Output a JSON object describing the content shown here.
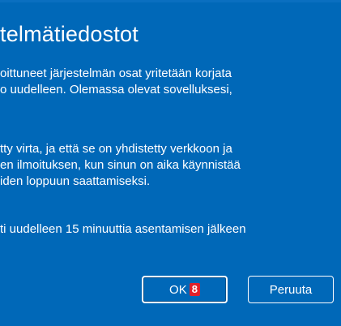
{
  "dialog": {
    "title": "telmätiedostot",
    "paragraph1": [
      "oittuneet järjestelmän osat yritetään korjata",
      "o uudelleen. Olemassa olevat sovelluksesi,"
    ],
    "paragraph2": [
      "tty virta, ja että se on yhdistetty verkkoon ja",
      "en ilmoituksen, kun sinun on aika käynnistää",
      "iden loppuun saattamiseksi."
    ],
    "paragraph3": [
      "ti uudelleen 15 minuuttia asentamisen jälkeen"
    ]
  },
  "buttons": {
    "ok_label": "OK",
    "ok_badge": "8",
    "cancel_label": "Peruuta"
  },
  "colors": {
    "background": "#0068b8",
    "text": "#ffffff",
    "badge": "#e0202a"
  }
}
